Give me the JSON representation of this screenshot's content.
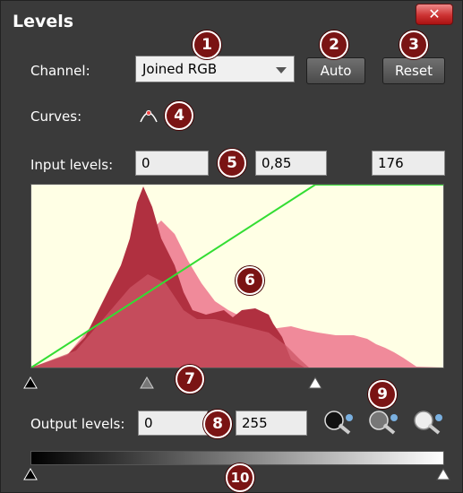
{
  "window": {
    "title": "Levels",
    "close_label": "✕"
  },
  "channel": {
    "label": "Channel:",
    "value": "Joined RGB"
  },
  "buttons": {
    "auto": "Auto",
    "reset": "Reset"
  },
  "curves": {
    "label": "Curves:",
    "icon": "curve-icon"
  },
  "input_levels": {
    "label": "Input levels:",
    "black": "0",
    "gamma": "0,85",
    "white": "176"
  },
  "output_levels": {
    "label": "Output levels:",
    "black": "0",
    "white": "255"
  },
  "callouts": [
    "1",
    "2",
    "3",
    "4",
    "5",
    "6",
    "7",
    "8",
    "9",
    "10"
  ],
  "eyedroppers": [
    {
      "name": "black-eyedropper-icon"
    },
    {
      "name": "gray-eyedropper-icon"
    },
    {
      "name": "white-eyedropper-icon"
    }
  ],
  "colors": {
    "background": "#3a3a3a",
    "histogram_bg": "#ffffe5",
    "dark_red": "#b03040",
    "light_pink": "#f08a9a",
    "curve_green": "#33dd33",
    "callout": "#7a1414"
  }
}
